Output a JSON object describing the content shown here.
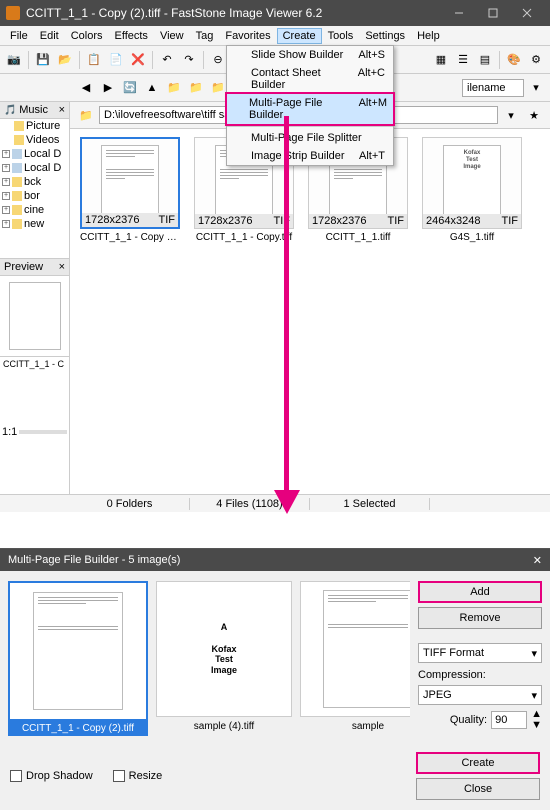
{
  "window": {
    "title": "CCITT_1_1 - Copy (2).tiff  -  FastStone Image Viewer 6.2"
  },
  "menu": {
    "items": [
      "File",
      "Edit",
      "Colors",
      "Effects",
      "View",
      "Tag",
      "Favorites",
      "Create",
      "Tools",
      "Settings",
      "Help"
    ],
    "active_index": 7,
    "dropdown": [
      {
        "label": "Slide Show Builder",
        "shortcut": "Alt+S"
      },
      {
        "label": "Contact Sheet Builder",
        "shortcut": "Alt+C"
      },
      {
        "label": "Multi-Page File Builder",
        "shortcut": "Alt+M",
        "highlight": true
      },
      {
        "label": "Multi-Page File Splitter",
        "shortcut": ""
      },
      {
        "label": "Image Strip Builder",
        "shortcut": "Alt+T"
      }
    ]
  },
  "toolbar": {
    "sort_label": "ilename"
  },
  "sidebar": {
    "head": "Music",
    "items": [
      "Picture",
      "Videos",
      "Local D",
      "Local D",
      "bck",
      "bor",
      "cine",
      "new"
    ],
    "preview_head": "Preview",
    "zoom": "1:1",
    "preview_name": "CCITT_1_1 - C"
  },
  "path": {
    "value": "D:\\ilovefreesoftware\\tiff sample"
  },
  "thumbs": [
    {
      "dims": "1728x2376",
      "fmt": "TIF",
      "name": "CCITT_1_1 - Copy (2)...",
      "selected": true
    },
    {
      "dims": "1728x2376",
      "fmt": "TIF",
      "name": "CCITT_1_1 - Copy.tiff"
    },
    {
      "dims": "1728x2376",
      "fmt": "TIF",
      "name": "CCITT_1_1.tiff"
    },
    {
      "dims": "2464x3248",
      "fmt": "TIF",
      "name": "G4S_1.tiff",
      "kofax": true
    }
  ],
  "status": {
    "folders": "0 Folders",
    "files": "4 Files (1108)",
    "selected": "1 Selected"
  },
  "dialog": {
    "title": "Multi-Page File Builder  -  5 image(s)",
    "thumbs": [
      {
        "name": "CCITT_1_1 - Copy (2).tiff",
        "selected": true
      },
      {
        "name": "sample (4).tiff",
        "kofax": true
      },
      {
        "name": "sample"
      }
    ],
    "buttons": {
      "add": "Add",
      "remove": "Remove",
      "create": "Create",
      "close": "Close"
    },
    "format": "TIFF Format",
    "compression_label": "Compression:",
    "compression": "JPEG",
    "quality_label": "Quality:",
    "quality": "90",
    "drop_shadow": "Drop Shadow",
    "resize": "Resize"
  }
}
